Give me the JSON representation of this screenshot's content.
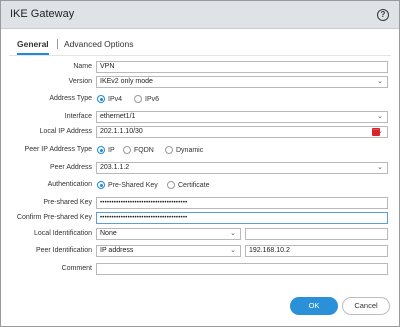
{
  "dialog": {
    "title": "IKE Gateway",
    "help_icon": "help-icon"
  },
  "tabs": [
    {
      "label": "General",
      "active": true
    },
    {
      "label": "Advanced Options",
      "active": false
    }
  ],
  "form": {
    "name": {
      "label": "Name",
      "value": "VPN"
    },
    "version": {
      "label": "Version",
      "value": "IKEv2 only mode"
    },
    "address_type": {
      "label": "Address Type",
      "options": [
        "IPv4",
        "IPv6"
      ],
      "selected": "IPv4"
    },
    "interface": {
      "label": "Interface",
      "value": "ethernet1/1"
    },
    "local_ip": {
      "label": "Local IP Address",
      "value": "202.1.1.10/30"
    },
    "peer_ip_type": {
      "label": "Peer IP Address Type",
      "options": [
        "IP",
        "FQDN",
        "Dynamic"
      ],
      "selected": "IP"
    },
    "peer_address": {
      "label": "Peer Address",
      "value": "203.1.1.2"
    },
    "authentication": {
      "label": "Authentication",
      "options": [
        "Pre-Shared Key",
        "Certificate"
      ],
      "selected": "Pre-Shared Key"
    },
    "psk": {
      "label": "Pre-shared Key",
      "value": "••••••••••••••••••••••••••••••••••••••"
    },
    "psk_confirm": {
      "label": "Confirm Pre-shared Key",
      "value": "••••••••••••••••••••••••••••••••••••••"
    },
    "local_id": {
      "label": "Local Identification",
      "type": "None",
      "value": ""
    },
    "peer_id": {
      "label": "Peer Identification",
      "type": "IP address",
      "value": "192.168.10.2"
    },
    "comment": {
      "label": "Comment",
      "value": ""
    }
  },
  "buttons": {
    "ok": "OK",
    "cancel": "Cancel"
  },
  "colors": {
    "accent": "#2a91d8",
    "titlebar": "#dfe3e8",
    "warning": "#d9232a"
  }
}
